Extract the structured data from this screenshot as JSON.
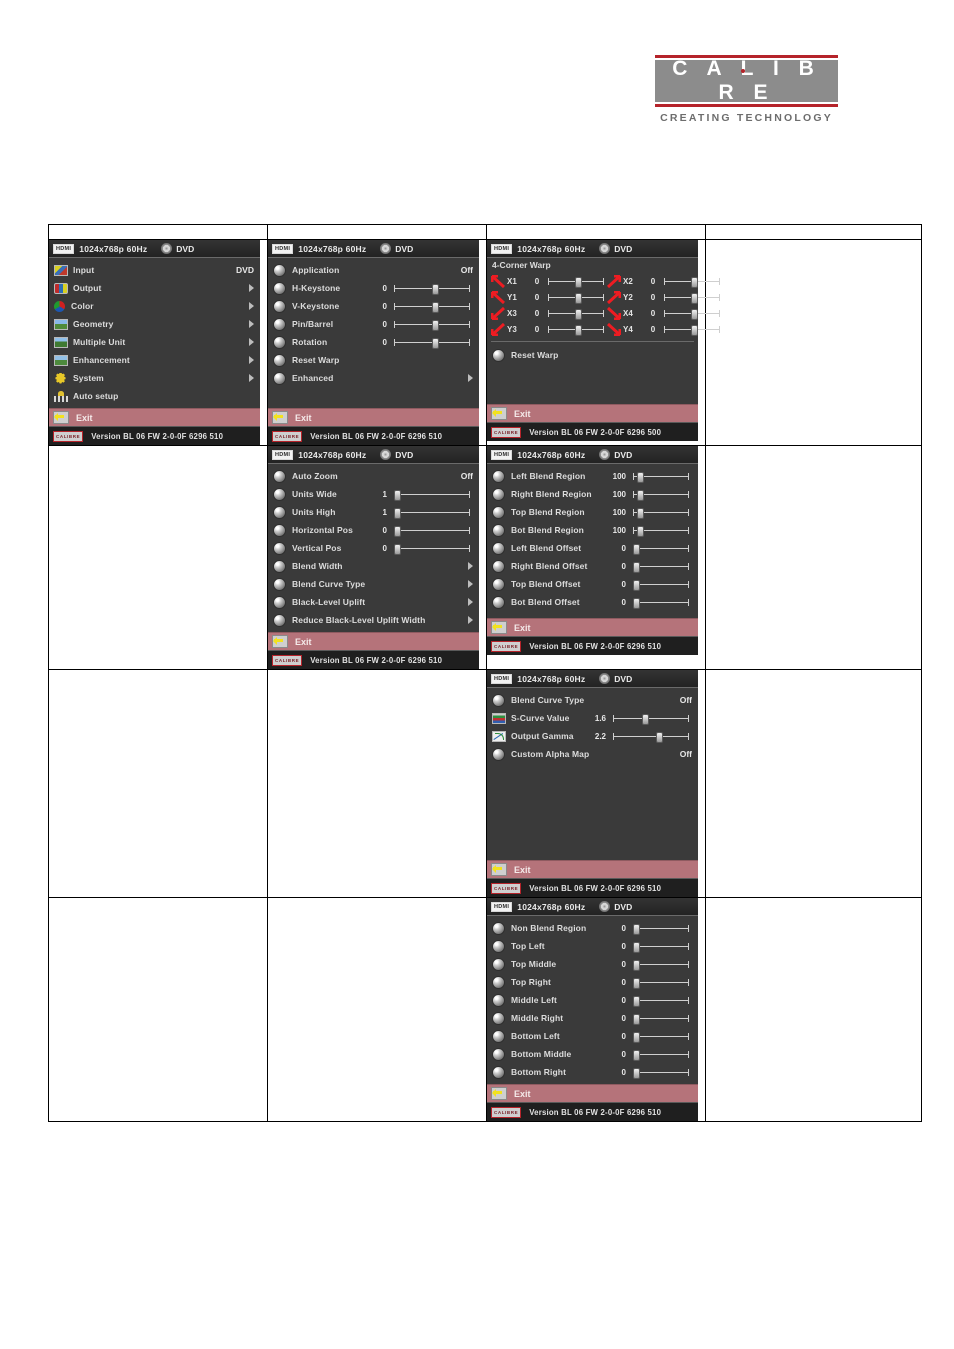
{
  "brand": {
    "name": "C A L I B R E",
    "tagline": "CREATING TECHNOLOGY",
    "accent": "#b5232a",
    "box": "#8c8c8c"
  },
  "osd_common": {
    "hdmi_badge": "HDMI",
    "resolution": "1024x768p 60Hz",
    "source": "DVD",
    "exit_label": "Exit",
    "version_logo": "CALIBRE",
    "version_text": "Version BL 06 FW 2-0-0F 6296 510",
    "version_text_alt": "Version BL 06 FW 2-0-0F 6296 500"
  },
  "panels": {
    "main_menu": {
      "rows": [
        {
          "icon": "input-icon",
          "label": "Input",
          "value": "DVD",
          "kind": "value"
        },
        {
          "icon": "output-icon",
          "label": "Output",
          "value": "",
          "kind": "submenu"
        },
        {
          "icon": "color-icon",
          "label": "Color",
          "value": "",
          "kind": "submenu"
        },
        {
          "icon": "geometry-icon",
          "label": "Geometry",
          "value": "",
          "kind": "submenu"
        },
        {
          "icon": "multiple-unit-icon",
          "label": "Multiple Unit",
          "value": "",
          "kind": "submenu"
        },
        {
          "icon": "enhancement-icon",
          "label": "Enhancement",
          "value": "",
          "kind": "submenu"
        },
        {
          "icon": "system-icon",
          "label": "System",
          "value": "",
          "kind": "submenu"
        },
        {
          "icon": "auto-setup-icon",
          "label": "Auto setup",
          "value": "",
          "kind": "plain"
        }
      ]
    },
    "geometry_menu": {
      "rows": [
        {
          "icon": "bullet-icon",
          "label": "Application",
          "value": "Off",
          "kind": "value"
        },
        {
          "icon": "bullet-icon",
          "label": "H-Keystone",
          "value": "0",
          "kind": "slider",
          "pos": 50
        },
        {
          "icon": "bullet-icon",
          "label": "V-Keystone",
          "value": "0",
          "kind": "slider",
          "pos": 50
        },
        {
          "icon": "bullet-icon",
          "label": "Pin/Barrel",
          "value": "0",
          "kind": "slider",
          "pos": 50
        },
        {
          "icon": "bullet-icon",
          "label": "Rotation",
          "value": "0",
          "kind": "slider",
          "pos": 50
        },
        {
          "icon": "bullet-icon",
          "label": "Reset Warp",
          "value": "",
          "kind": "plain"
        },
        {
          "icon": "bullet-icon",
          "label": "Enhanced",
          "value": "",
          "kind": "submenu"
        }
      ]
    },
    "corner_warp": {
      "title": "4-Corner Warp",
      "left_rows": [
        {
          "arrow": "arrow-up-left-icon",
          "label": "X1",
          "value": "0",
          "pos": 50
        },
        {
          "arrow": "arrow-up-left-icon",
          "label": "Y1",
          "value": "0",
          "pos": 50
        },
        {
          "arrow": "arrow-down-left-icon",
          "label": "X3",
          "value": "0",
          "pos": 50
        },
        {
          "arrow": "arrow-down-left-icon",
          "label": "Y3",
          "value": "0",
          "pos": 50
        }
      ],
      "right_rows": [
        {
          "arrow": "arrow-up-right-icon",
          "label": "X2",
          "value": "0",
          "pos": 50
        },
        {
          "arrow": "arrow-up-right-icon",
          "label": "Y2",
          "value": "0",
          "pos": 50
        },
        {
          "arrow": "arrow-down-right-icon",
          "label": "X4",
          "value": "0",
          "pos": 50
        },
        {
          "arrow": "arrow-down-right-icon",
          "label": "Y4",
          "value": "0",
          "pos": 50
        }
      ],
      "reset": {
        "icon": "bullet-icon",
        "label": "Reset Warp"
      }
    },
    "multiple_unit": {
      "rows": [
        {
          "icon": "bullet-icon",
          "label": "Auto Zoom",
          "value": "Off",
          "kind": "value"
        },
        {
          "icon": "bullet-icon",
          "label": "Units Wide",
          "value": "1",
          "kind": "slider",
          "pos": 2
        },
        {
          "icon": "bullet-icon",
          "label": "Units High",
          "value": "1",
          "kind": "slider",
          "pos": 2
        },
        {
          "icon": "bullet-icon",
          "label": "Horizontal Pos",
          "value": "0",
          "kind": "slider",
          "pos": 2
        },
        {
          "icon": "bullet-icon",
          "label": "Vertical Pos",
          "value": "0",
          "kind": "slider",
          "pos": 2
        },
        {
          "icon": "bullet-icon",
          "label": "Blend Width",
          "value": "",
          "kind": "submenu"
        },
        {
          "icon": "bullet-icon",
          "label": "Blend Curve Type",
          "value": "",
          "kind": "submenu"
        },
        {
          "icon": "bullet-icon",
          "label": "Black-Level Uplift",
          "value": "",
          "kind": "submenu"
        },
        {
          "icon": "bullet-icon",
          "label": "Reduce Black-Level Uplift Width",
          "value": "",
          "kind": "submenu"
        }
      ]
    },
    "blend_width": {
      "rows": [
        {
          "icon": "bullet-icon",
          "label": "Left Blend Region",
          "value": "100",
          "kind": "slider",
          "pos": 8
        },
        {
          "icon": "bullet-icon",
          "label": "Right Blend Region",
          "value": "100",
          "kind": "slider",
          "pos": 8
        },
        {
          "icon": "bullet-icon",
          "label": "Top Blend Region",
          "value": "100",
          "kind": "slider",
          "pos": 8
        },
        {
          "icon": "bullet-icon",
          "label": "Bot Blend Region",
          "value": "100",
          "kind": "slider",
          "pos": 8
        },
        {
          "icon": "bullet-icon",
          "label": "Left Blend Offset",
          "value": "0",
          "kind": "slider",
          "pos": 2
        },
        {
          "icon": "bullet-icon",
          "label": "Right Blend Offset",
          "value": "0",
          "kind": "slider",
          "pos": 2
        },
        {
          "icon": "bullet-icon",
          "label": "Top Blend Offset",
          "value": "0",
          "kind": "slider",
          "pos": 2
        },
        {
          "icon": "bullet-icon",
          "label": "Bot Blend Offset",
          "value": "0",
          "kind": "slider",
          "pos": 2
        }
      ]
    },
    "blend_curve": {
      "rows": [
        {
          "icon": "bullet-icon",
          "label": "Blend Curve Type",
          "value": "Off",
          "kind": "value"
        },
        {
          "icon": "s-curve-icon",
          "label": "S-Curve Value",
          "value": "1.6",
          "kind": "slider",
          "pos": 38
        },
        {
          "icon": "gamma-icon",
          "label": "Output Gamma",
          "value": "2.2",
          "kind": "slider",
          "pos": 56
        },
        {
          "icon": "bullet-icon",
          "label": "Custom Alpha Map",
          "value": "Off",
          "kind": "value"
        }
      ]
    },
    "black_level": {
      "rows": [
        {
          "icon": "bullet-icon",
          "label": "Non Blend Region",
          "value": "0",
          "kind": "slider",
          "pos": 2
        },
        {
          "icon": "bullet-icon",
          "label": "Top Left",
          "value": "0",
          "kind": "slider",
          "pos": 2
        },
        {
          "icon": "bullet-icon",
          "label": "Top Middle",
          "value": "0",
          "kind": "slider",
          "pos": 2
        },
        {
          "icon": "bullet-icon",
          "label": "Top Right",
          "value": "0",
          "kind": "slider",
          "pos": 2
        },
        {
          "icon": "bullet-icon",
          "label": "Middle Left",
          "value": "0",
          "kind": "slider",
          "pos": 2
        },
        {
          "icon": "bullet-icon",
          "label": "Middle Right",
          "value": "0",
          "kind": "slider",
          "pos": 2
        },
        {
          "icon": "bullet-icon",
          "label": "Bottom Left",
          "value": "0",
          "kind": "slider",
          "pos": 2
        },
        {
          "icon": "bullet-icon",
          "label": "Bottom Middle",
          "value": "0",
          "kind": "slider",
          "pos": 2
        },
        {
          "icon": "bottom-right-icon",
          "label": "Bottom Right",
          "value": "0",
          "kind": "slider",
          "pos": 2
        }
      ]
    }
  }
}
